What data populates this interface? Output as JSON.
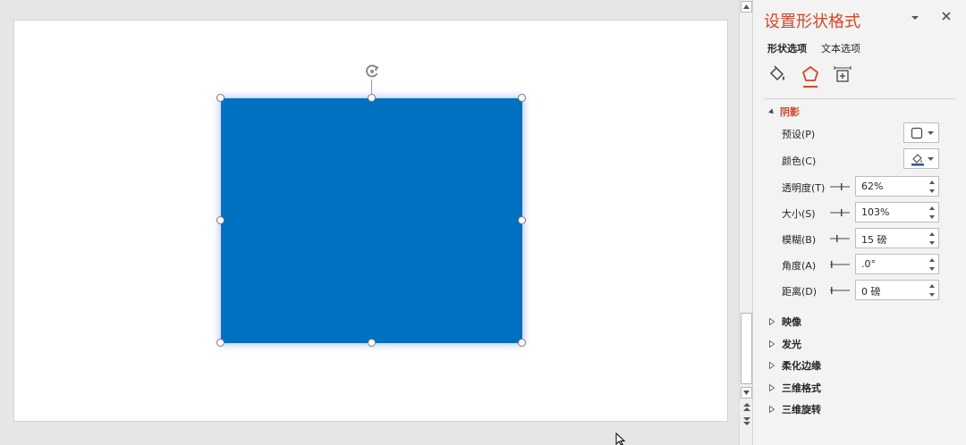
{
  "pane": {
    "title": "设置形状格式",
    "tabs": {
      "shape_options": "形状选项",
      "text_options": "文本选项"
    },
    "category_icons": [
      "fill-line-icon",
      "effects-icon",
      "size-properties-icon"
    ],
    "accent_color": "#d24726"
  },
  "shadow": {
    "section_label": "阴影",
    "preset_label": "预设(P)",
    "color_label": "颜色(C)",
    "transparency_label": "透明度(T)",
    "transparency_value": "62%",
    "size_label": "大小(S)",
    "size_value": "103%",
    "blur_label": "模糊(B)",
    "blur_value": "15 磅",
    "angle_label": "角度(A)",
    "angle_value": ".0°",
    "distance_label": "距离(D)",
    "distance_value": "0 磅"
  },
  "sections": [
    {
      "label": "映像"
    },
    {
      "label": "发光"
    },
    {
      "label": "柔化边缘"
    },
    {
      "label": "三维格式"
    },
    {
      "label": "三维旋转"
    }
  ],
  "shape": {
    "fill_color": "#0070c0"
  }
}
